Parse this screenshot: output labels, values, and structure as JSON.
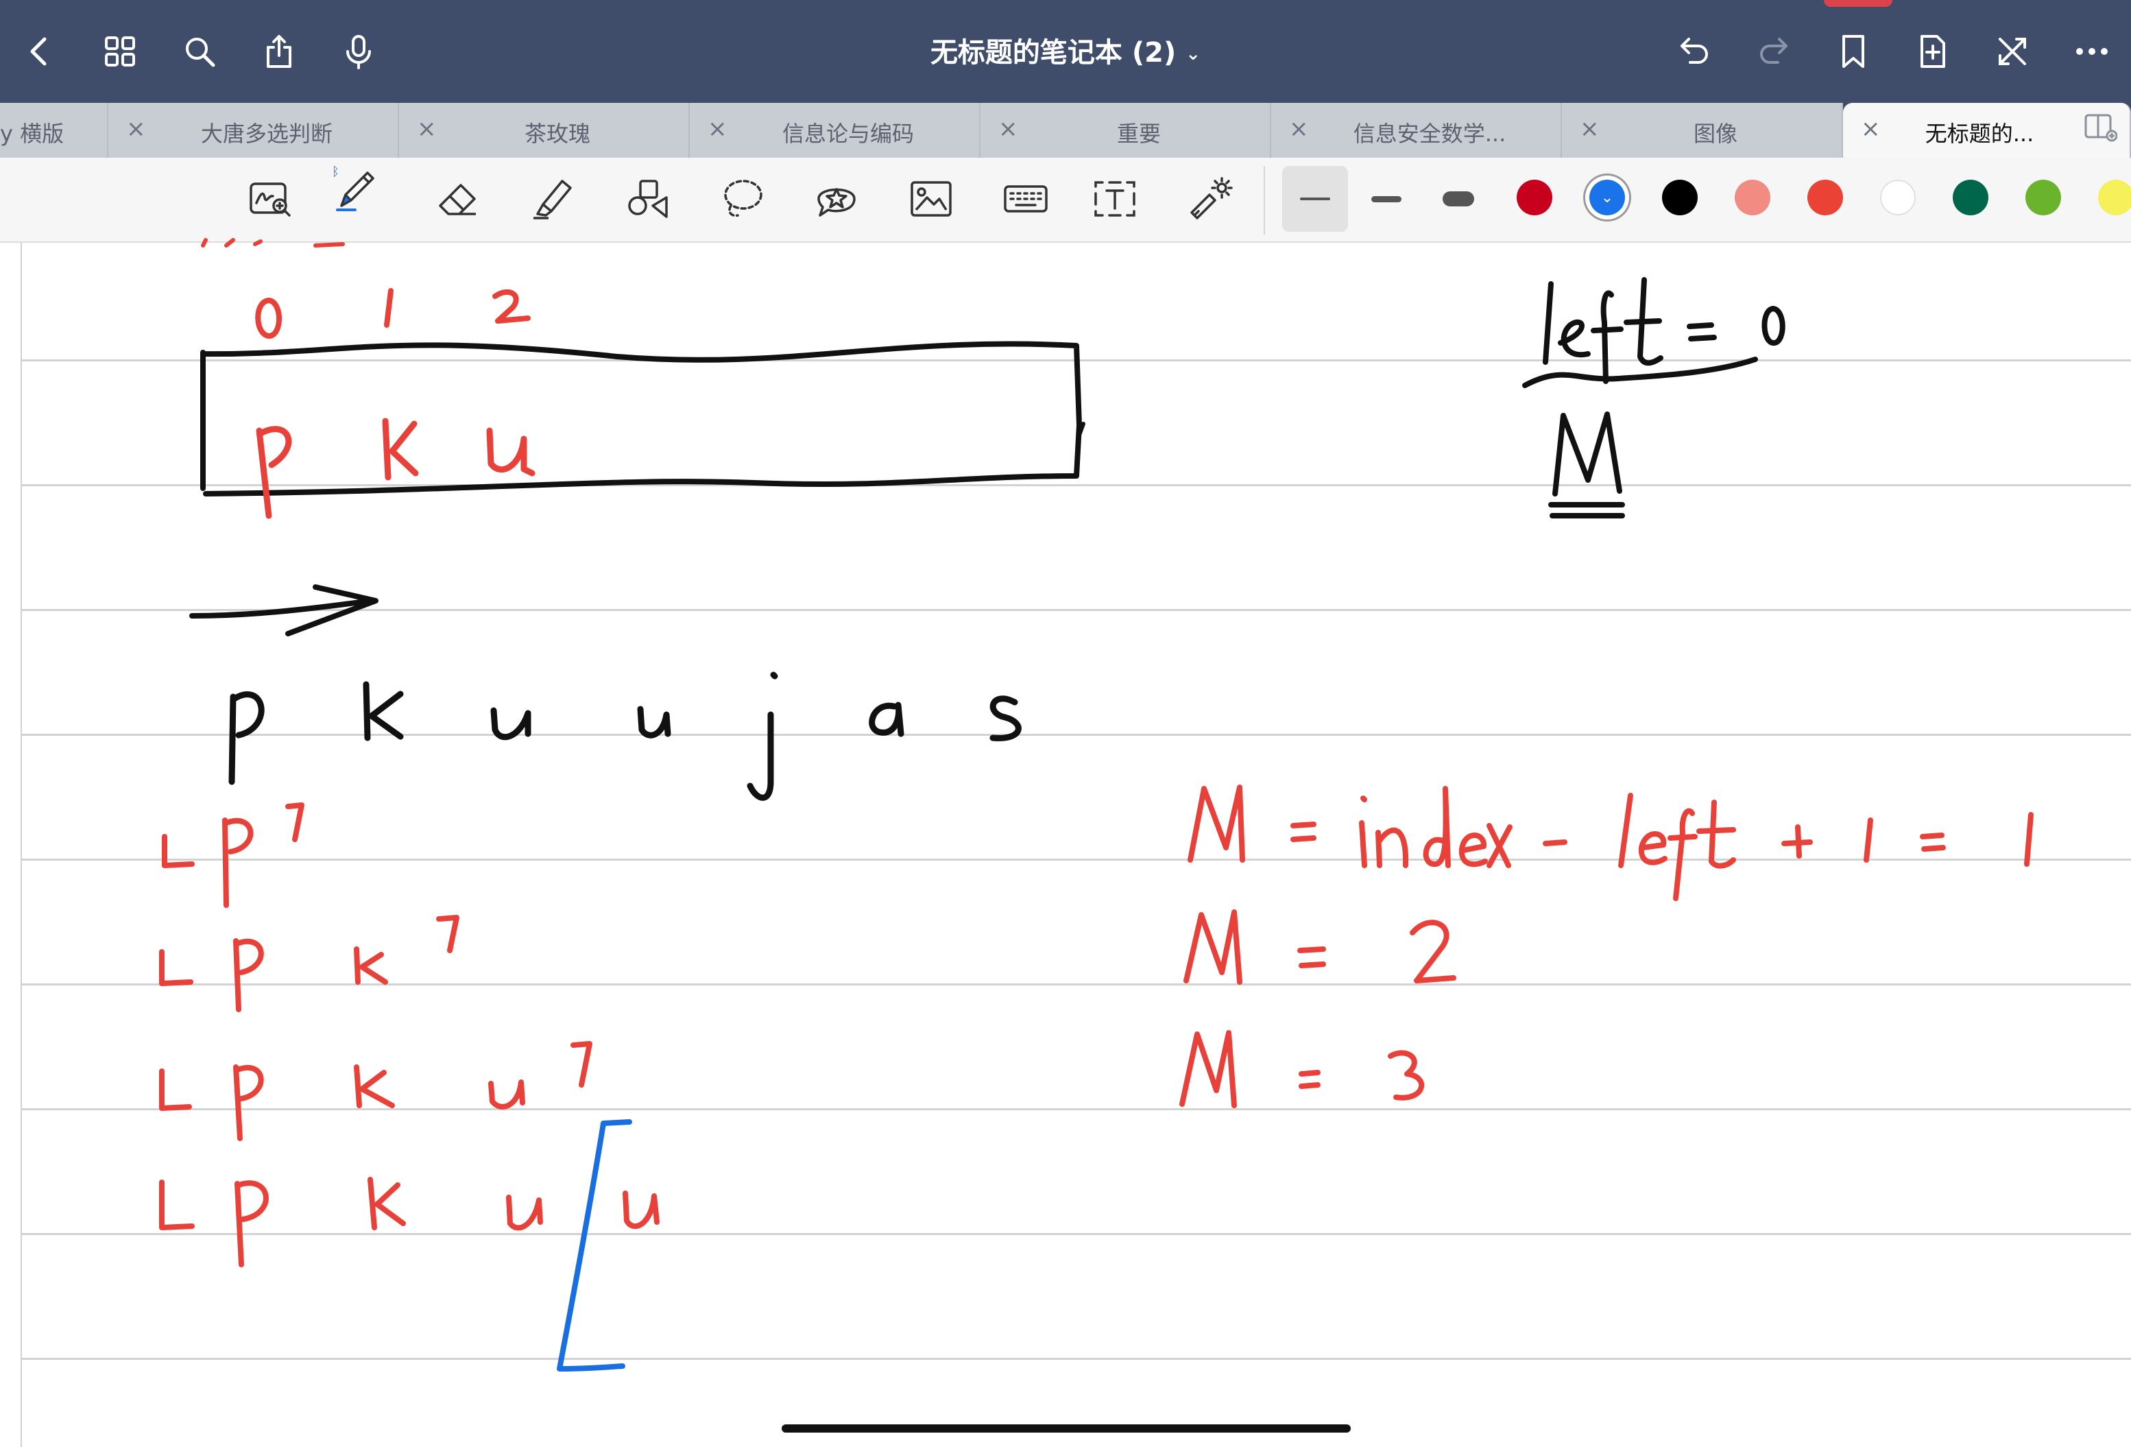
{
  "app": {
    "title": "无标题的笔记本 (2)"
  },
  "tabs": [
    {
      "label": "y 横版",
      "active": false
    },
    {
      "label": "大唐多选判断",
      "active": false
    },
    {
      "label": "茶玫瑰",
      "active": false
    },
    {
      "label": "信息论与编码",
      "active": false
    },
    {
      "label": "重要",
      "active": false
    },
    {
      "label": "信息安全数学...",
      "active": false
    },
    {
      "label": "图像",
      "active": false
    },
    {
      "label": "无标题的...",
      "active": true
    }
  ],
  "toolbar": {
    "tools": [
      "zoom-window-icon",
      "pen-icon",
      "eraser-icon",
      "highlighter-icon",
      "shapes-icon",
      "lasso-icon",
      "sticker-icon",
      "image-icon",
      "keyboard-icon",
      "text-box-icon",
      "laser-pointer-icon"
    ],
    "selected_tool": "pen-icon"
  },
  "colors": {
    "swatches": [
      "#c8001e",
      "#1a73e8",
      "#000000",
      "#f28b82",
      "#ea4335",
      "#ffffff",
      "#00664b",
      "#6ab42d",
      "#f6f05a"
    ],
    "selected": "#1a73e8"
  },
  "note": {
    "black_text": [
      "left = 0",
      "M",
      "p k u u j a s"
    ],
    "red_text": [
      "0 1 2",
      "p k u",
      "[p]",
      "[p k]",
      "[p k u]",
      "[p k u [u",
      "M = index - left + 1 = 1",
      "M = 2",
      "M = 3"
    ]
  }
}
